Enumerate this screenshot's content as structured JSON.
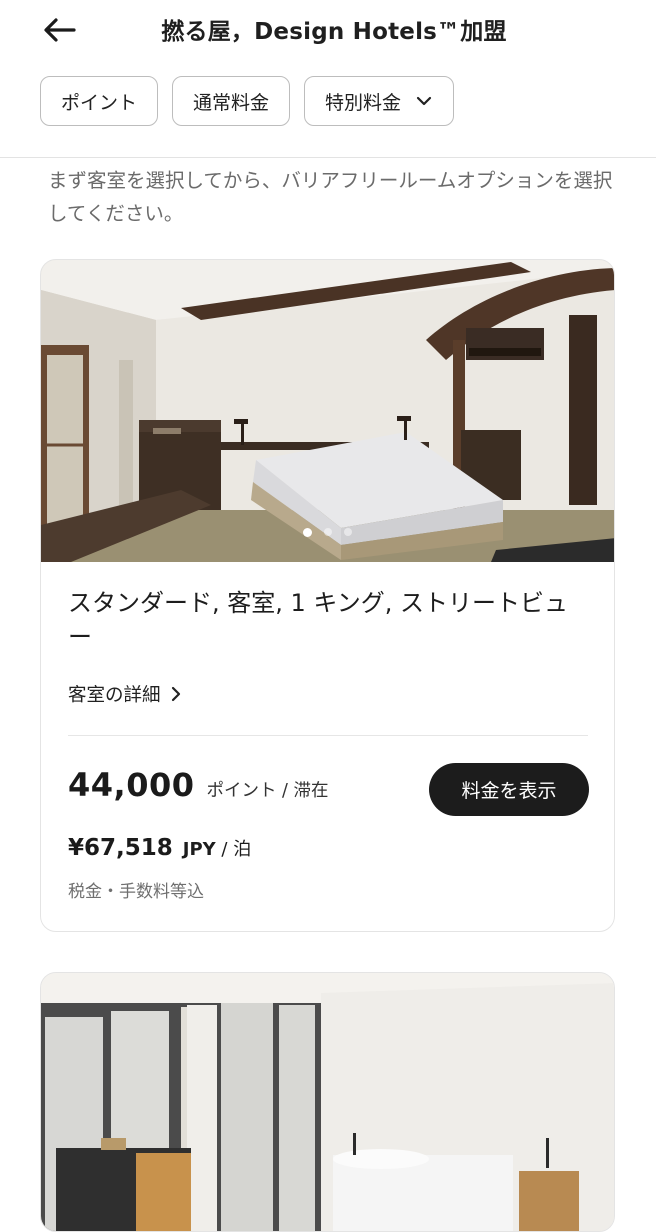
{
  "header": {
    "title": "撚る屋，Design Hotels™加盟",
    "back_icon": "arrow-left-icon"
  },
  "filters": [
    {
      "label": "ポイント"
    },
    {
      "label": "通常料金"
    },
    {
      "label": "特別料金",
      "icon": "chevron-down-icon"
    }
  ],
  "notice": "まず客室を選択してから、バリアフリールームオプションを選択してください。",
  "cards": [
    {
      "room_name": "スタンダード, 客室, 1 キング, ストリートビュー",
      "details_label": "客室の詳細",
      "points_value": "44,000",
      "points_unit": "ポイント / 滞在",
      "rate_button": "料金を表示",
      "price_amount": "¥67,518",
      "price_currency": "JPY",
      "price_per": " / 泊",
      "tax_note": "税金・手数料等込",
      "carousel": {
        "total": 3,
        "active": 1
      }
    }
  ],
  "colors": {
    "button_bg": "#1c1c1c",
    "muted_text": "#6b6b6b",
    "chip_border": "#bdbdbd"
  }
}
